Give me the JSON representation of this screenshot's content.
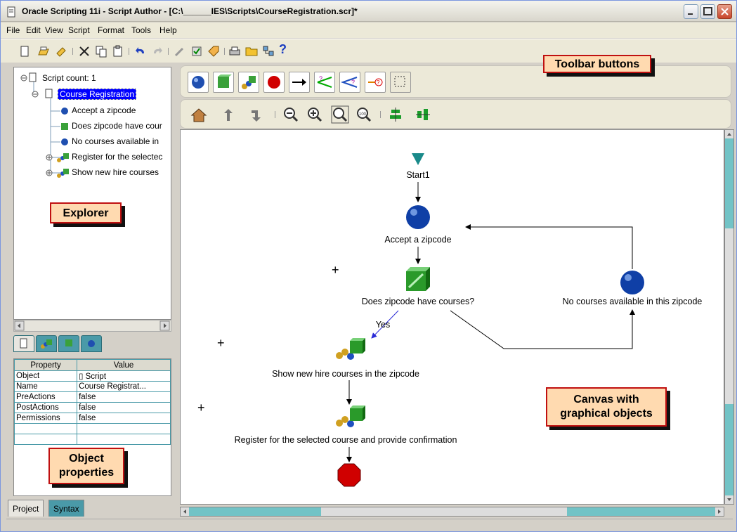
{
  "window": {
    "title": "Oracle Scripting 11i - Script Author - [C:\\______IES\\Scripts\\CourseRegistration.scr]*"
  },
  "menu": [
    "File",
    "Edit",
    "View",
    "Script",
    "Format",
    "Tools",
    "Help"
  ],
  "toolbar": {
    "icons": [
      "new-script-icon",
      "open-icon",
      "edit-icon",
      "cut-icon",
      "copy-icon",
      "paste-icon",
      "undo-icon",
      "redo-icon",
      "wand-icon",
      "compile-icon",
      "tag-icon",
      "print-icon",
      "folder-icon",
      "deploy-icon",
      "help-icon"
    ],
    "help_glyph": "?"
  },
  "explorer": {
    "nodes": [
      {
        "label": "Script count:  1",
        "depth": 0
      },
      {
        "label": "Course Registration",
        "depth": 1,
        "selected": true
      },
      {
        "label": "Accept a zipcode",
        "depth": 2,
        "icon": "panel-icon"
      },
      {
        "label": "Does zipcode have cour",
        "depth": 2,
        "icon": "block-icon"
      },
      {
        "label": "No courses available in",
        "depth": 2,
        "icon": "panel-icon"
      },
      {
        "label": "Register for the selectec",
        "depth": 2,
        "icon": "group-icon",
        "expandable": true
      },
      {
        "label": "Show new hire courses",
        "depth": 2,
        "icon": "group-icon",
        "expandable": true
      }
    ]
  },
  "properties": {
    "headers": [
      "Property",
      "Value"
    ],
    "rows": [
      [
        "Object",
        "Script"
      ],
      [
        "Name",
        "Course Registrat..."
      ],
      [
        "PreActions",
        "false"
      ],
      [
        "PostActions",
        "false"
      ],
      [
        "Permissions",
        "false"
      ],
      [
        "",
        ""
      ],
      [
        "",
        ""
      ]
    ]
  },
  "bottom_tabs": [
    "Project",
    "Syntax"
  ],
  "canvas": {
    "start_label": "Start1",
    "accept": "Accept a zipcode",
    "does": "Does zipcode have courses?",
    "yes": "Yes",
    "nocourses": "No courses available in this zipcode",
    "show": "Show new hire courses in the zipcode",
    "register": "Register for the selected course and provide confirmation",
    "plus": "+"
  },
  "callouts": {
    "toolbar": "Toolbar buttons",
    "explorer": "Explorer",
    "props_line1": "Object",
    "props_line2": "properties",
    "canvas_line1": "Canvas with",
    "canvas_line2": "graphical objects"
  },
  "colors": {
    "panel_teal": "#4a9aa8",
    "callout_fill": "#ffdab0",
    "callout_border": "#c01010",
    "selected_bg": "#0000ff"
  }
}
